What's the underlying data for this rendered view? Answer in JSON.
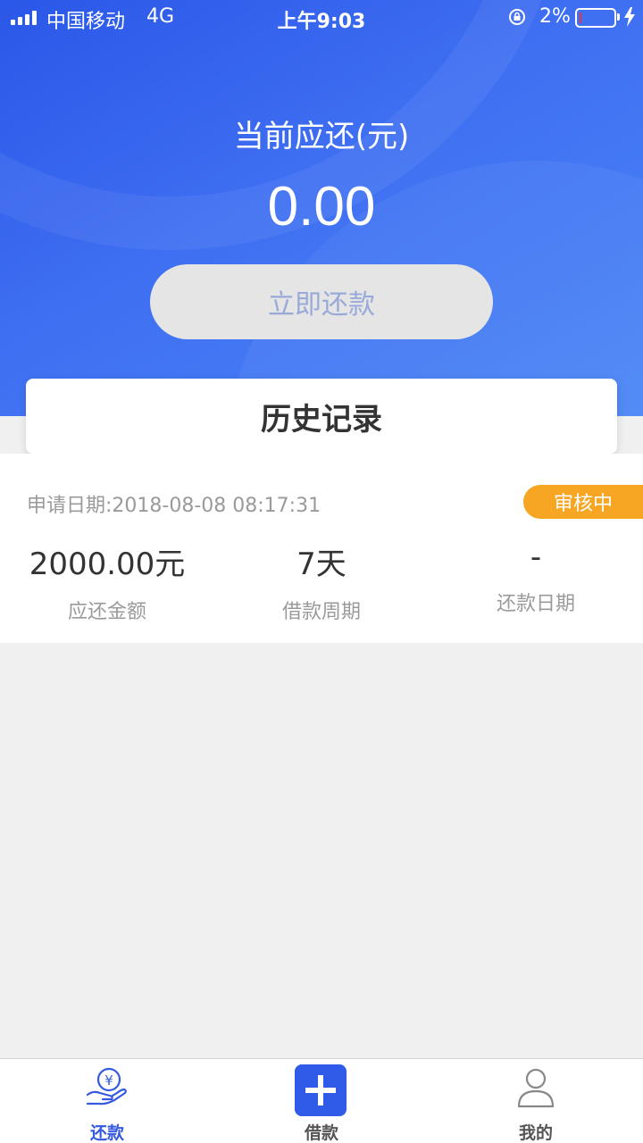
{
  "status_bar": {
    "carrier": "中国移动",
    "network": "4G",
    "time": "上午9:03",
    "battery_percent": "2%"
  },
  "hero": {
    "label": "当前应还(元)",
    "amount": "0.00",
    "repay_button": "立即还款"
  },
  "history": {
    "title": "历史记录",
    "record": {
      "date": "申请日期:2018-08-08 08:17:31",
      "status": "审核中",
      "amount_value": "2000.00元",
      "amount_label": "应还金额",
      "period_value": "7天",
      "period_label": "借款周期",
      "repay_date_value": "-",
      "repay_date_label": "还款日期"
    }
  },
  "tabbar": {
    "repay": "还款",
    "borrow": "借款",
    "mine": "我的"
  },
  "colors": {
    "primary": "#2f5be8",
    "status_badge": "#f6a623"
  }
}
